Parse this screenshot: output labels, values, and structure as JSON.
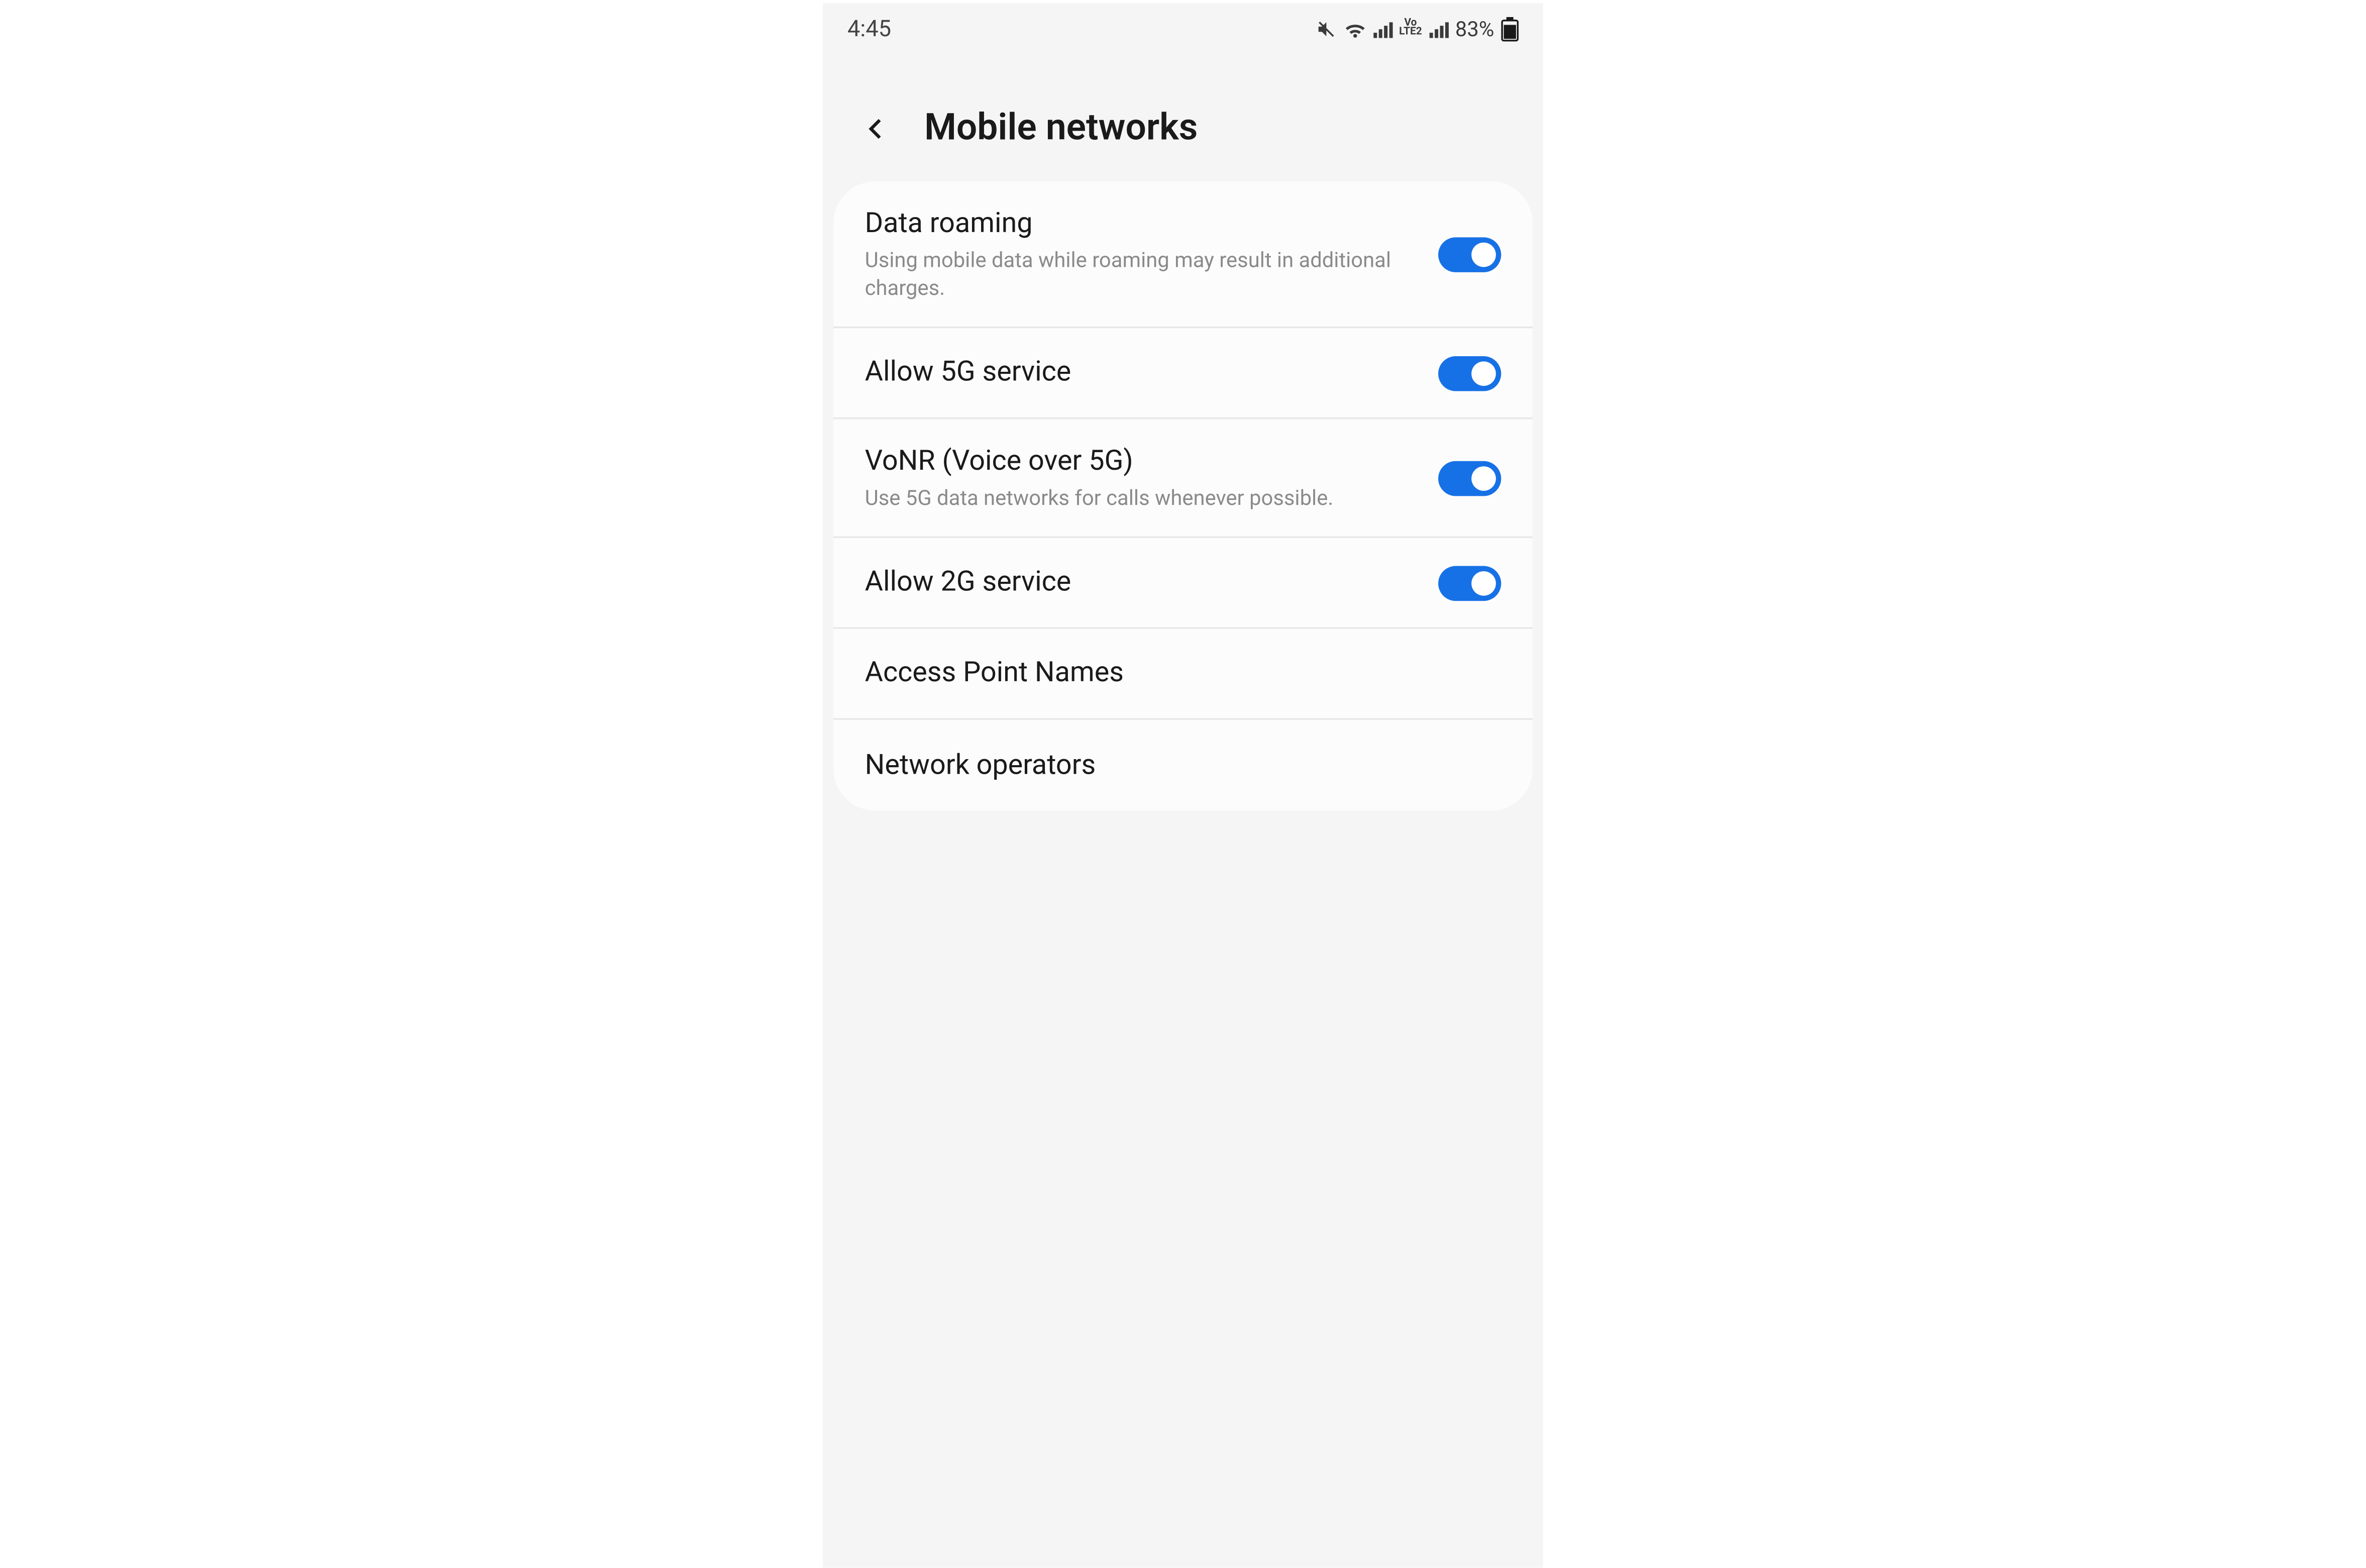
{
  "status_bar": {
    "time": "4:45",
    "battery_percent": "83%",
    "vo_label_line1": "Vo",
    "vo_label_line2": "LTE2"
  },
  "header": {
    "title": "Mobile networks"
  },
  "settings": {
    "data_roaming": {
      "title": "Data roaming",
      "subtitle": "Using mobile data while roaming may result in additional charges.",
      "on": true
    },
    "allow_5g": {
      "title": "Allow 5G service",
      "on": true
    },
    "vonr": {
      "title": "VoNR (Voice over 5G)",
      "subtitle": "Use 5G data networks for calls whenever possible.",
      "on": true
    },
    "allow_2g": {
      "title": "Allow 2G service",
      "on": true
    },
    "apn": {
      "title": "Access Point Names"
    },
    "operators": {
      "title": "Network operators"
    }
  }
}
